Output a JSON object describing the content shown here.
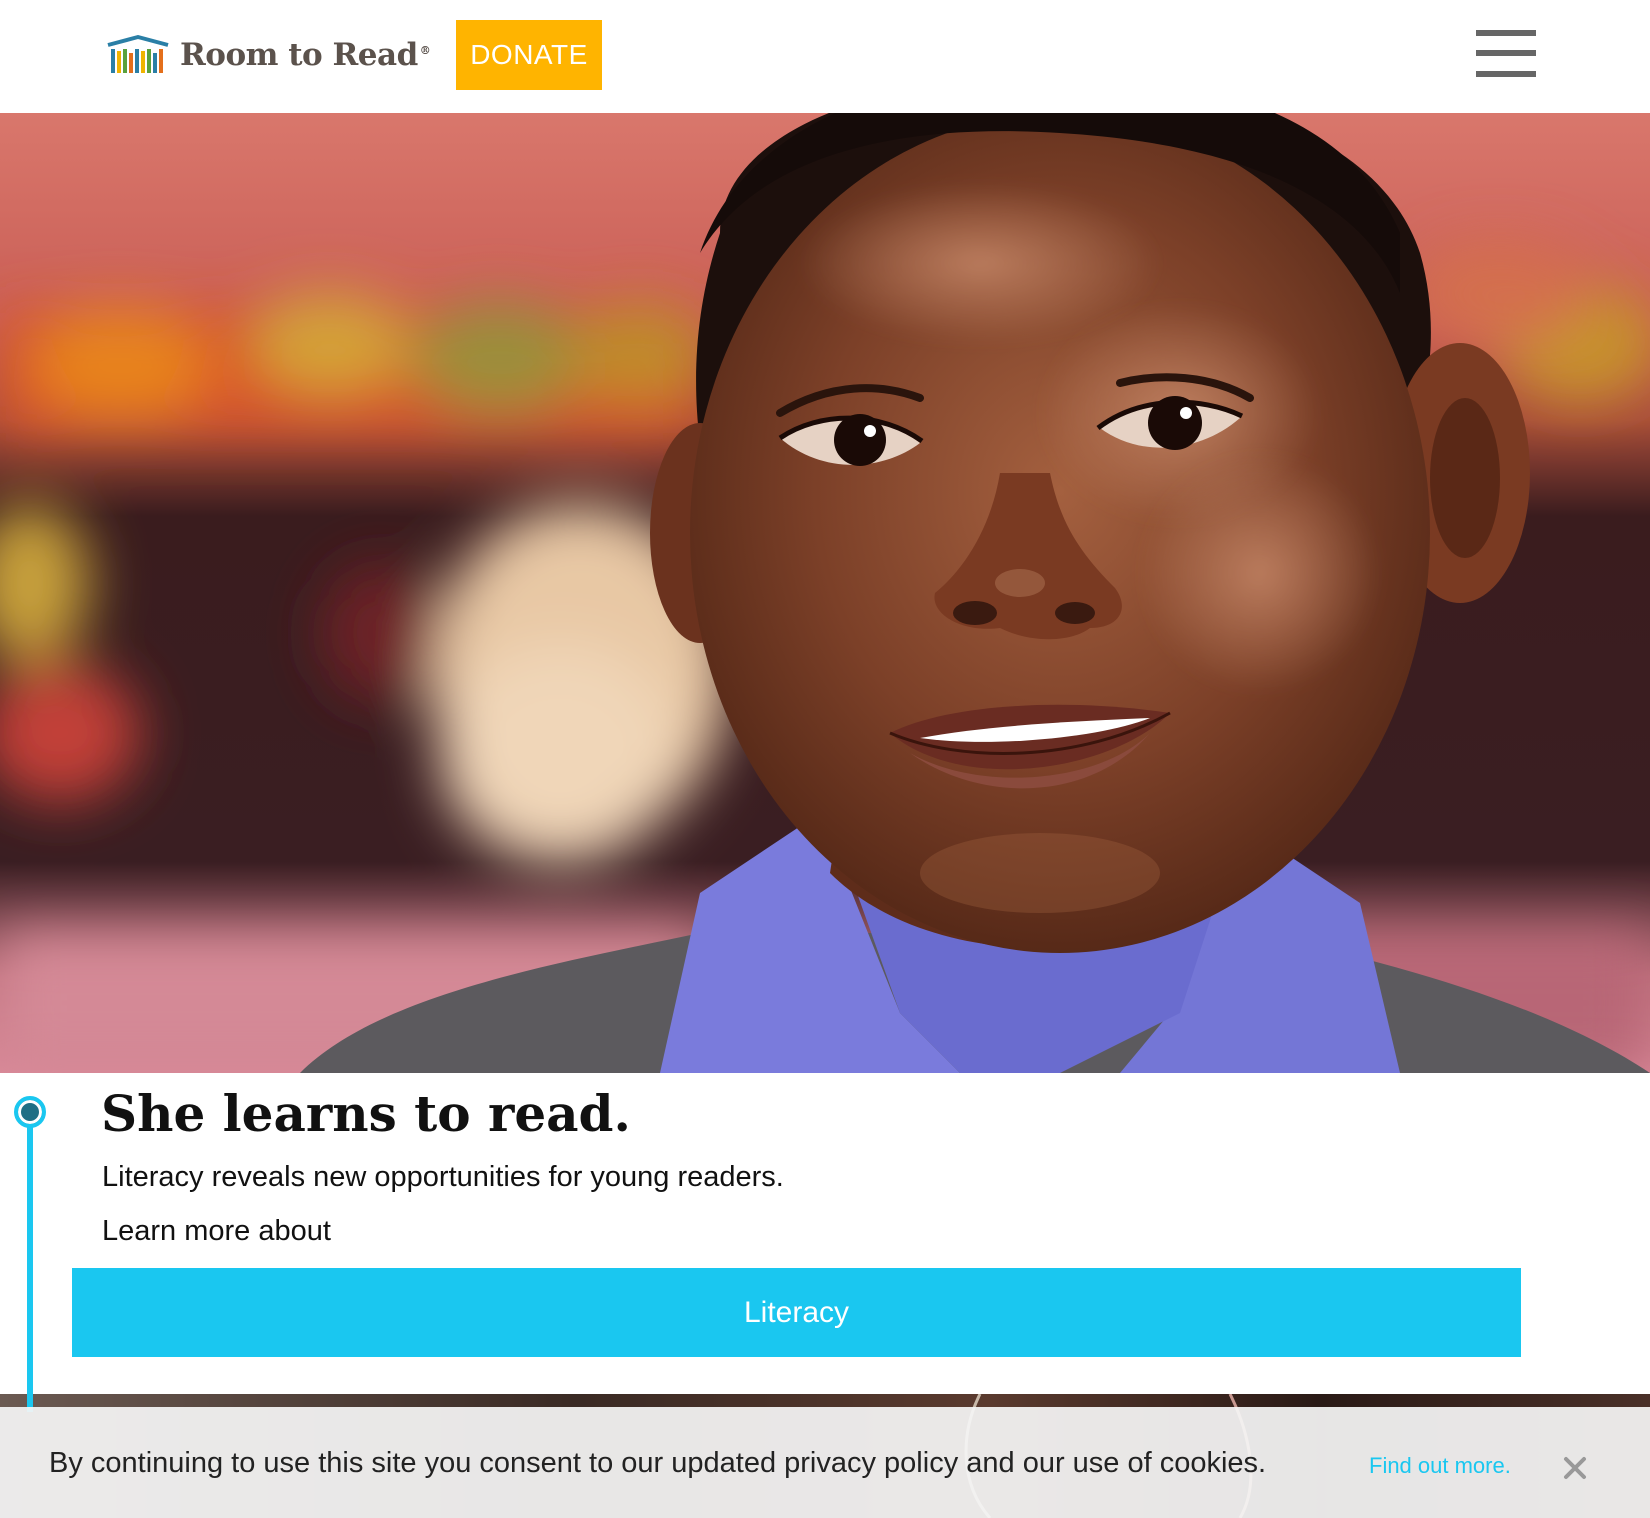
{
  "header": {
    "brand_name": "Room to Read",
    "brand_reg": "®",
    "donate_label": "DONATE",
    "menu_icon": "hamburger-menu-icon",
    "logo_icon": "bookshelf-logo-icon"
  },
  "hero": {
    "image_subject": "smiling-girl-portrait"
  },
  "story": {
    "title": "She learns to read.",
    "subtitle": "Literacy reveals new opportunities for young readers.",
    "learn_more": "Learn more about",
    "cta_label": "Literacy"
  },
  "cookie_banner": {
    "message": "By continuing to use this site you consent to our updated privacy policy and our use of cookies.",
    "link_label": "Find out more.",
    "close_icon": "close-icon"
  },
  "colors": {
    "donate": "#ffb400",
    "accent": "#1ac7f0",
    "brand_text": "#5b524c",
    "menu": "#666666"
  }
}
